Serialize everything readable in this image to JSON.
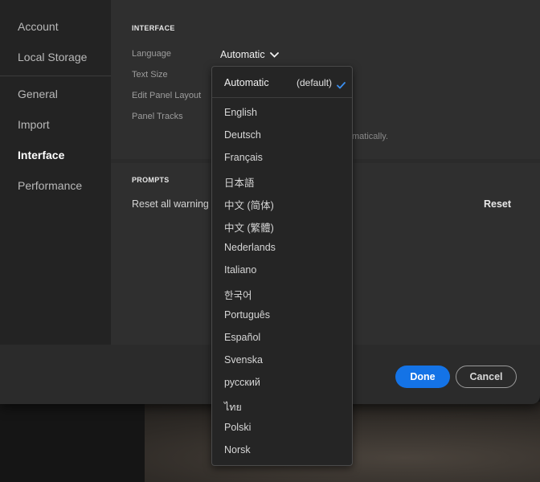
{
  "sidebar": {
    "items": [
      {
        "label": "Account",
        "active": false
      },
      {
        "label": "Local Storage",
        "active": false
      },
      {
        "label": "General",
        "active": false
      },
      {
        "label": "Import",
        "active": false
      },
      {
        "label": "Interface",
        "active": true
      },
      {
        "label": "Performance",
        "active": false
      }
    ]
  },
  "interface": {
    "heading": "INTERFACE",
    "language_label": "Language",
    "language_value": "Automatic",
    "text_size_label": "Text Size",
    "edit_panel_label": "Edit Panel Layout",
    "panel_tracks_label": "Panel Tracks",
    "hint_fragment": "matically."
  },
  "prompts": {
    "heading": "PROMPTS",
    "reset_label": "Reset all warning",
    "reset_button": "Reset"
  },
  "footer": {
    "done": "Done",
    "cancel": "Cancel"
  },
  "dropdown": {
    "selected": {
      "label": "Automatic",
      "suffix": "(default)"
    },
    "options": [
      "English",
      "Deutsch",
      "Français",
      "日本語",
      "中文 (简体)",
      "中文 (繁體)",
      "Nederlands",
      "Italiano",
      "한국어",
      "Português",
      "Español",
      "Svenska",
      "русский",
      "ไทย",
      "Polski",
      "Norsk"
    ]
  },
  "colors": {
    "accent": "#1473e6",
    "check": "#3b8ff0"
  }
}
